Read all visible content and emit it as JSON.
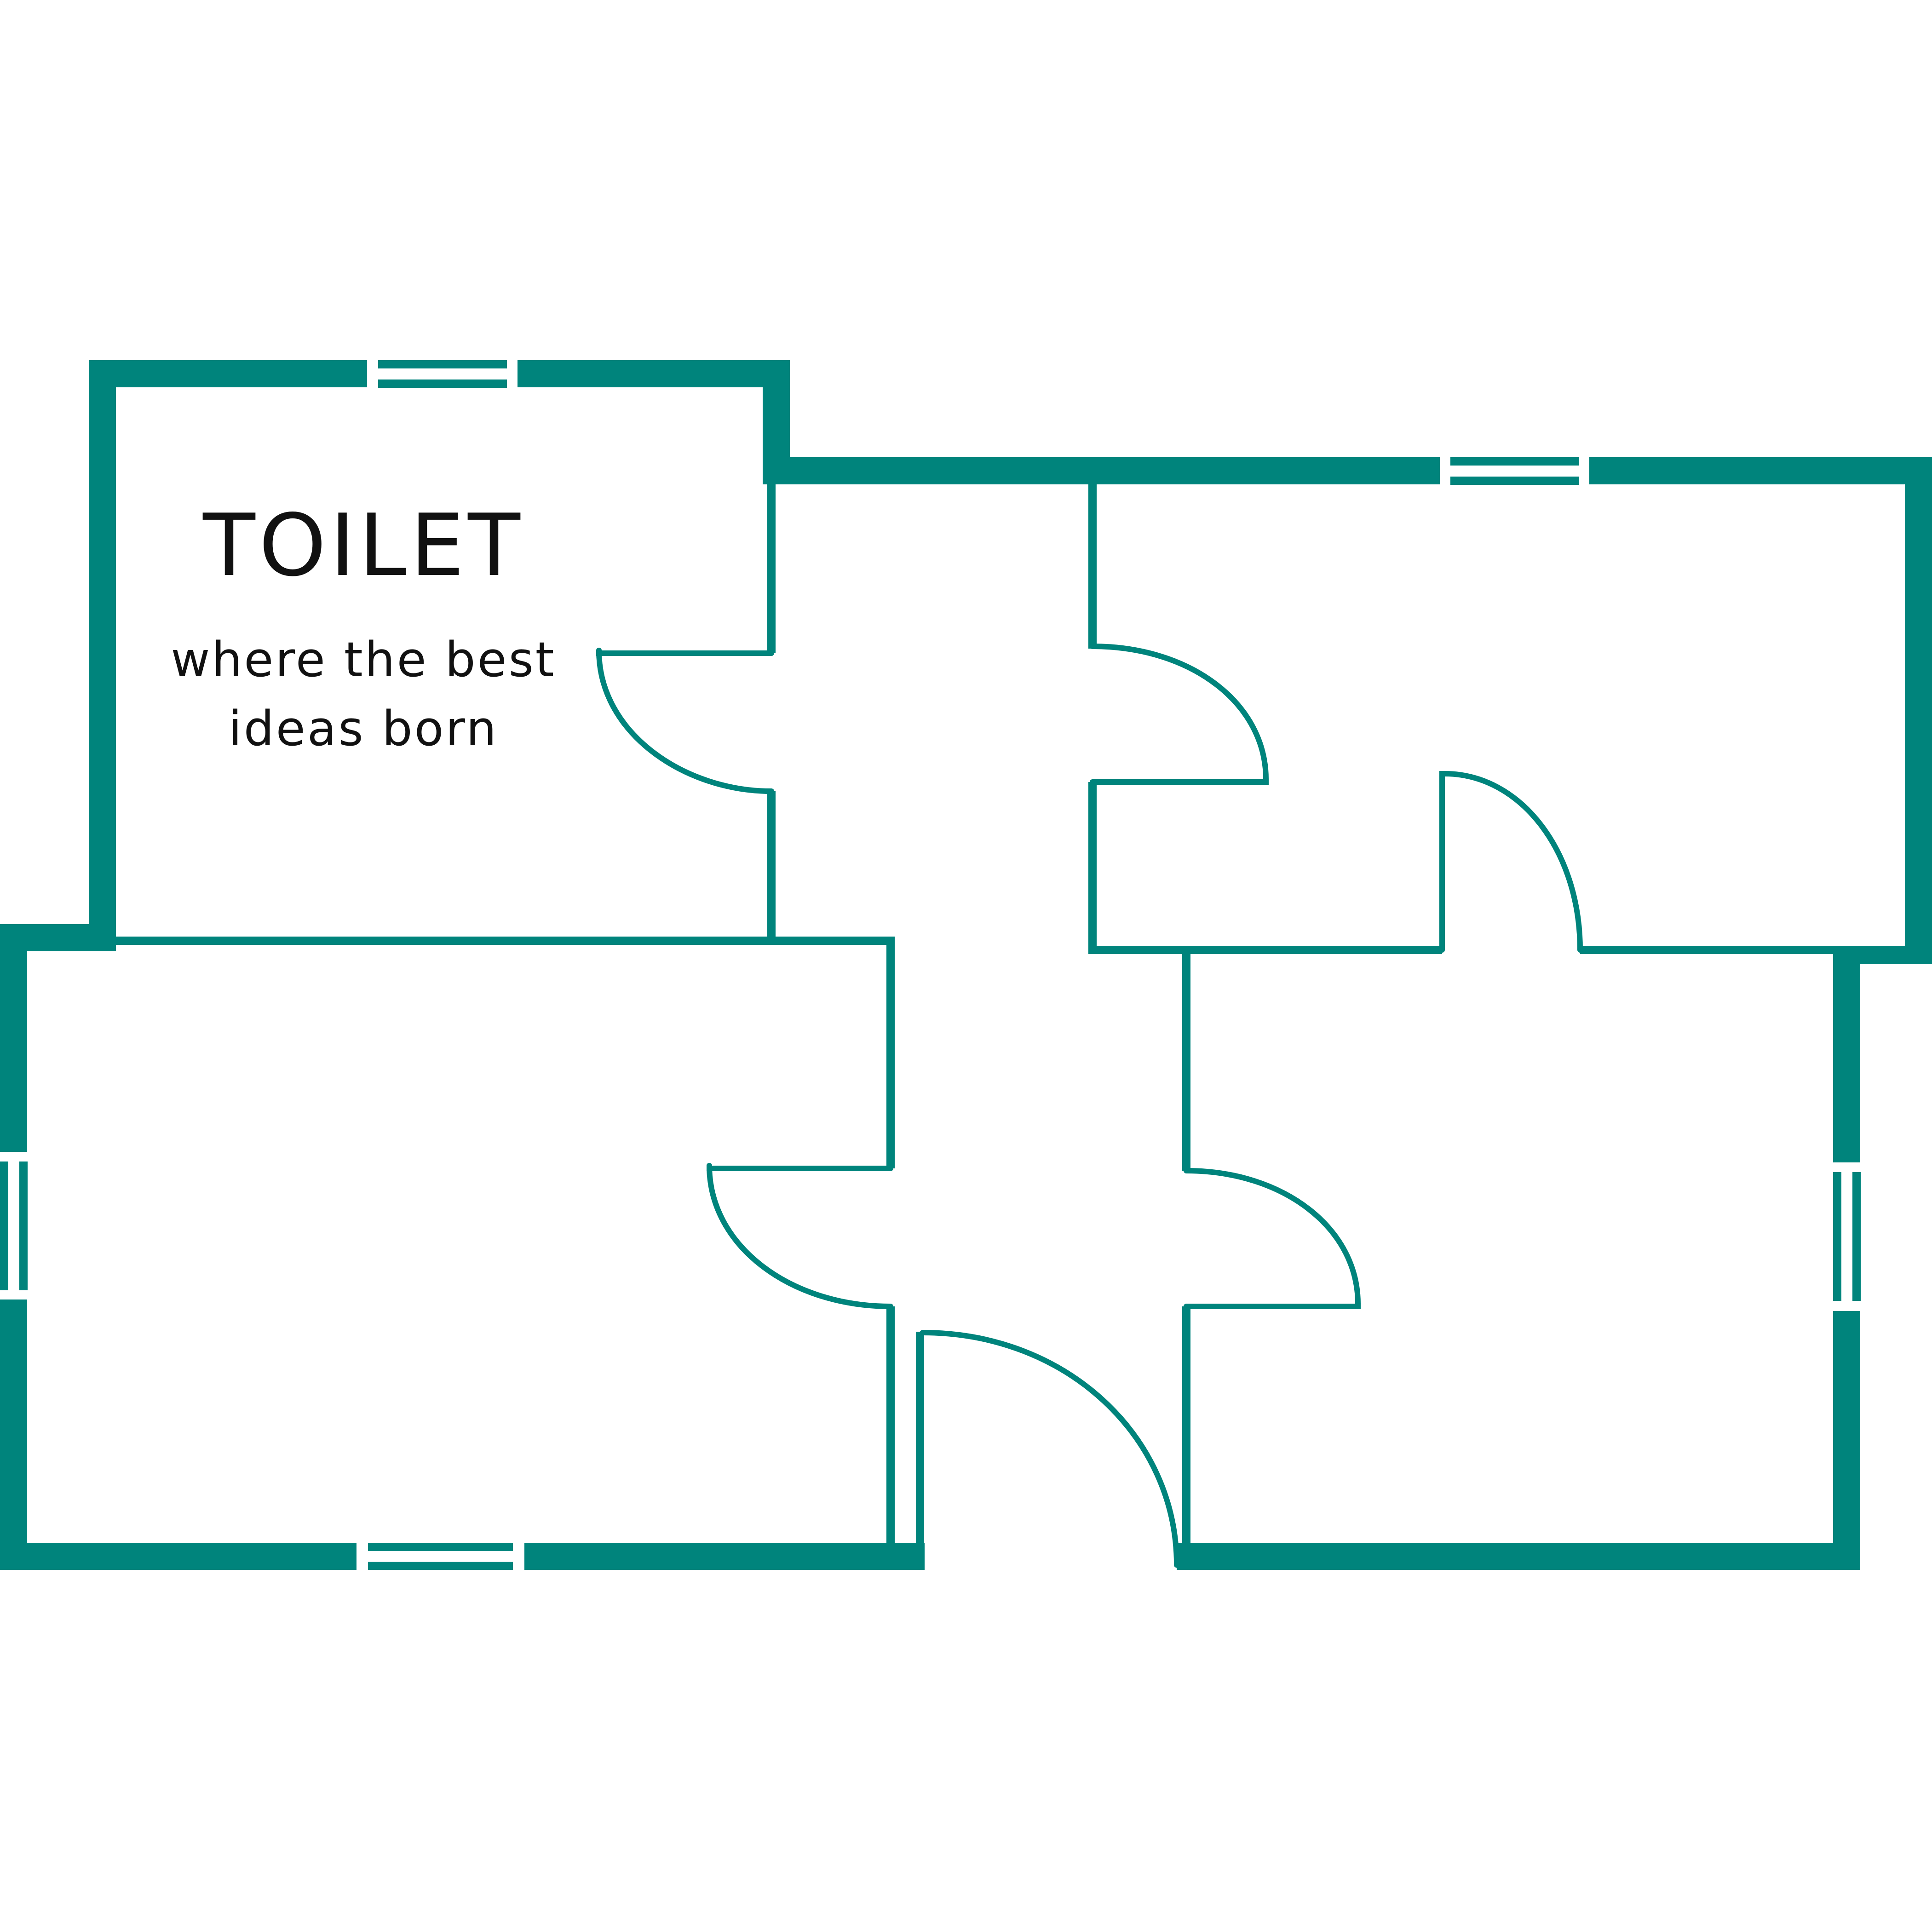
{
  "plan": {
    "room_label": {
      "title": "TOILET",
      "subtitle_line1": "where the best",
      "subtitle_line2": "ideas born"
    },
    "colors": {
      "wall": "#00847C",
      "text": "#111111",
      "background": "#FFFFFF"
    }
  }
}
